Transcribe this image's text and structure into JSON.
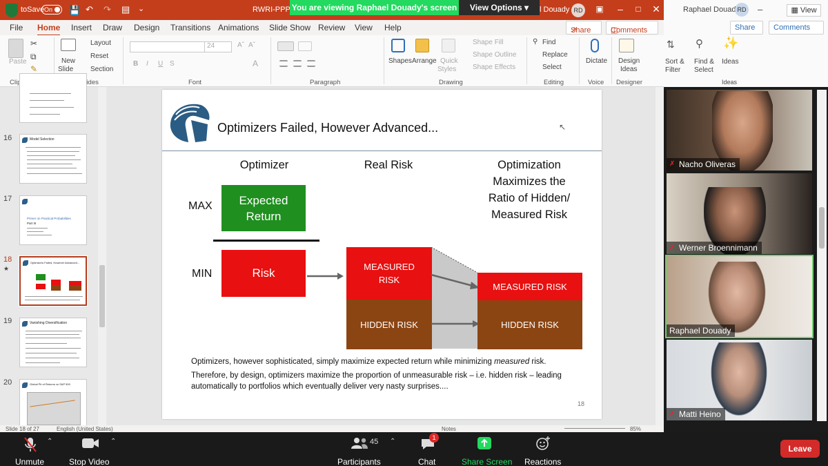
{
  "window": {
    "autosave_label": "toSave",
    "autosave_toggle": "On",
    "file_title": "RWRI-PPP Ra",
    "user_suffix": "l Douady",
    "user_initials": "RD"
  },
  "share_banner": {
    "message": "You are viewing Raphael Douady's screen",
    "view_options": "View Options"
  },
  "menu": {
    "tabs": [
      "File",
      "Home",
      "Insert",
      "Draw",
      "Design",
      "Transitions",
      "Animations",
      "Slide Show",
      "Review",
      "View",
      "Help"
    ],
    "active_tab": "Home",
    "share": "Share",
    "comments": "Comments"
  },
  "ribbon": {
    "clipboard": {
      "paste": "Paste",
      "group": "Clipboard"
    },
    "slides": {
      "new_slide": "New",
      "new_slide2": "Slide",
      "layout": "Layout",
      "reset": "Reset",
      "section": "Section",
      "group": "Slides"
    },
    "font": {
      "size": "24",
      "bold": "B",
      "italic": "I",
      "underline": "U",
      "strike": "S",
      "group": "Font"
    },
    "paragraph": {
      "group": "Paragraph"
    },
    "drawing": {
      "shapes": "Shapes",
      "arrange": "Arrange",
      "quick": "Quick",
      "styles": "Styles",
      "fill": "Shape Fill",
      "outline": "Shape Outline",
      "effects": "Shape Effects",
      "group": "Drawing"
    },
    "editing": {
      "find": "Find",
      "replace": "Replace",
      "select": "Select",
      "group": "Editing"
    },
    "voice": {
      "dictate": "Dictate",
      "group": "Voice"
    },
    "designer": {
      "design_ideas": "Design",
      "design_ideas2": "Ideas",
      "group": "Designer"
    }
  },
  "thumbnails": [
    {
      "num": "16",
      "title": "Model Selection"
    },
    {
      "num": "17",
      "title": "Primer on Practical Probabilities",
      "sub": "Part III"
    },
    {
      "num": "18",
      "title": "Optimizers Failed, However Advanced..."
    },
    {
      "num": "19",
      "title": "Vanishing Diversification"
    },
    {
      "num": "20",
      "title": "Global Pit of Returns vs S&P 500"
    }
  ],
  "slide": {
    "title": "Optimizers Failed, However Advanced...",
    "col_optimizer": "Optimizer",
    "col_real_risk": "Real Risk",
    "col_ratio": [
      "Optimization",
      "Maximizes the",
      "Ratio of Hidden/",
      "Measured Risk"
    ],
    "max_label": "MAX",
    "min_label": "MIN",
    "expected_return": [
      "Expected",
      "Return"
    ],
    "risk": "Risk",
    "measured_risk_left": [
      "MEASURED",
      "RISK"
    ],
    "hidden_risk_left": "HIDDEN RISK",
    "measured_risk_right": "MEASURED RISK",
    "hidden_risk_right": "HIDDEN RISK",
    "body_line1_a": "Optimizers, however sophisticated, simply maximize expected return while minimizing ",
    "body_line1_em": "measured",
    "body_line1_b": " risk.",
    "body_line2": "Therefore, by design, optimizers maximize the proportion of unmeasurable risk – i.e. hidden risk – leading",
    "body_line3": "automatically to portfolios which eventually deliver very nasty surprises....",
    "page_number": "18"
  },
  "status": {
    "slide_count": "Slide 18 of 27",
    "language": "English (United States)",
    "notes": "Notes",
    "zoom": "85%"
  },
  "right_pane": {
    "user": "Raphael Douady",
    "initials": "RD",
    "view": "View",
    "share": "Share",
    "comments": "Comments",
    "sort_filter": [
      "Sort &",
      "Filter"
    ],
    "find_select": [
      "Find &",
      "Select"
    ],
    "ideas": "Ideas",
    "group_ideas": "Ideas"
  },
  "participants": [
    {
      "name": "Nacho Oliveras",
      "muted": true
    },
    {
      "name": "Werner Broennimann",
      "muted": true
    },
    {
      "name": "Raphael Douady",
      "muted": false
    },
    {
      "name": "Matti Heino",
      "muted": true
    }
  ],
  "zoom_toolbar": {
    "unmute": "Unmute",
    "stop_video": "Stop Video",
    "participants": "Participants",
    "participant_count": "45",
    "chat": "Chat",
    "chat_badge": "1",
    "share_screen": "Share Screen",
    "reactions": "Reactions",
    "leave": "Leave"
  },
  "colors": {
    "ppt_accent": "#c43e1c",
    "green_box": "#1f8f1f",
    "red_box": "#e81010",
    "brown_box": "#8b4513",
    "zoom_green": "#23d95f",
    "leave_red": "#d32a2a"
  }
}
